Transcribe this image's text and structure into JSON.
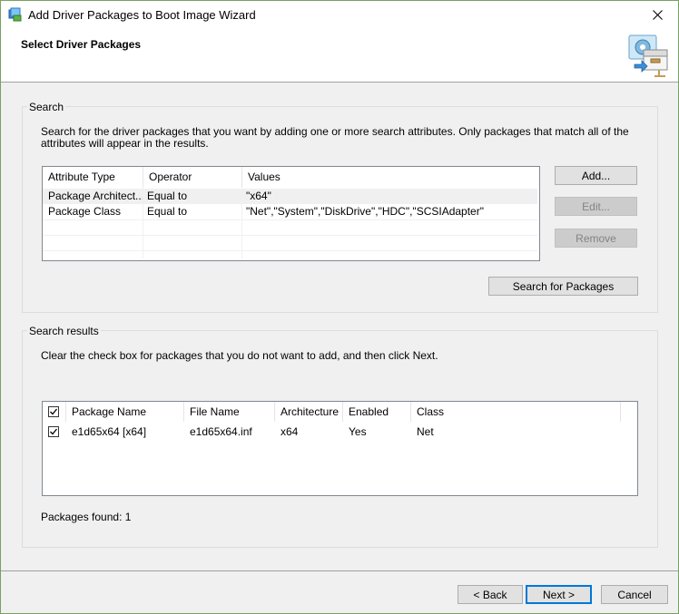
{
  "window": {
    "title": "Add Driver Packages to Boot Image Wizard",
    "page_title": "Select Driver Packages"
  },
  "search": {
    "group_label": "Search",
    "description": "Search for the driver packages that you want by adding one or more search attributes. Only packages that match all of the attributes will appear in the results.",
    "columns": [
      "Attribute Type",
      "Operator",
      "Values"
    ],
    "rows": [
      [
        "Package Architect...",
        "Equal to",
        "\"x64\""
      ],
      [
        "Package Class",
        "Equal to",
        "\"Net\",\"System\",\"DiskDrive\",\"HDC\",\"SCSIAdapter\""
      ]
    ],
    "add_label": "Add...",
    "edit_label": "Edit...",
    "remove_label": "Remove",
    "search_button_label": "Search for Packages"
  },
  "results": {
    "group_label": "Search results",
    "description": "Clear the check box for packages that you do not want to add, and then click Next.",
    "columns": [
      "Package Name",
      "File Name",
      "Architecture",
      "Enabled",
      "Class"
    ],
    "rows": [
      {
        "checked": true,
        "cells": [
          "e1d65x64 [x64]",
          "e1d65x64.inf",
          "x64",
          "Yes",
          "Net"
        ]
      }
    ],
    "header_checked": true,
    "packages_found": "Packages found: 1"
  },
  "footer": {
    "back_label": "< Back",
    "next_label": "Next >",
    "cancel_label": "Cancel"
  },
  "colors": {
    "window_border": "#7aa060",
    "selected_row": "#f0f0f0",
    "default_button_border": "#0078d7"
  }
}
